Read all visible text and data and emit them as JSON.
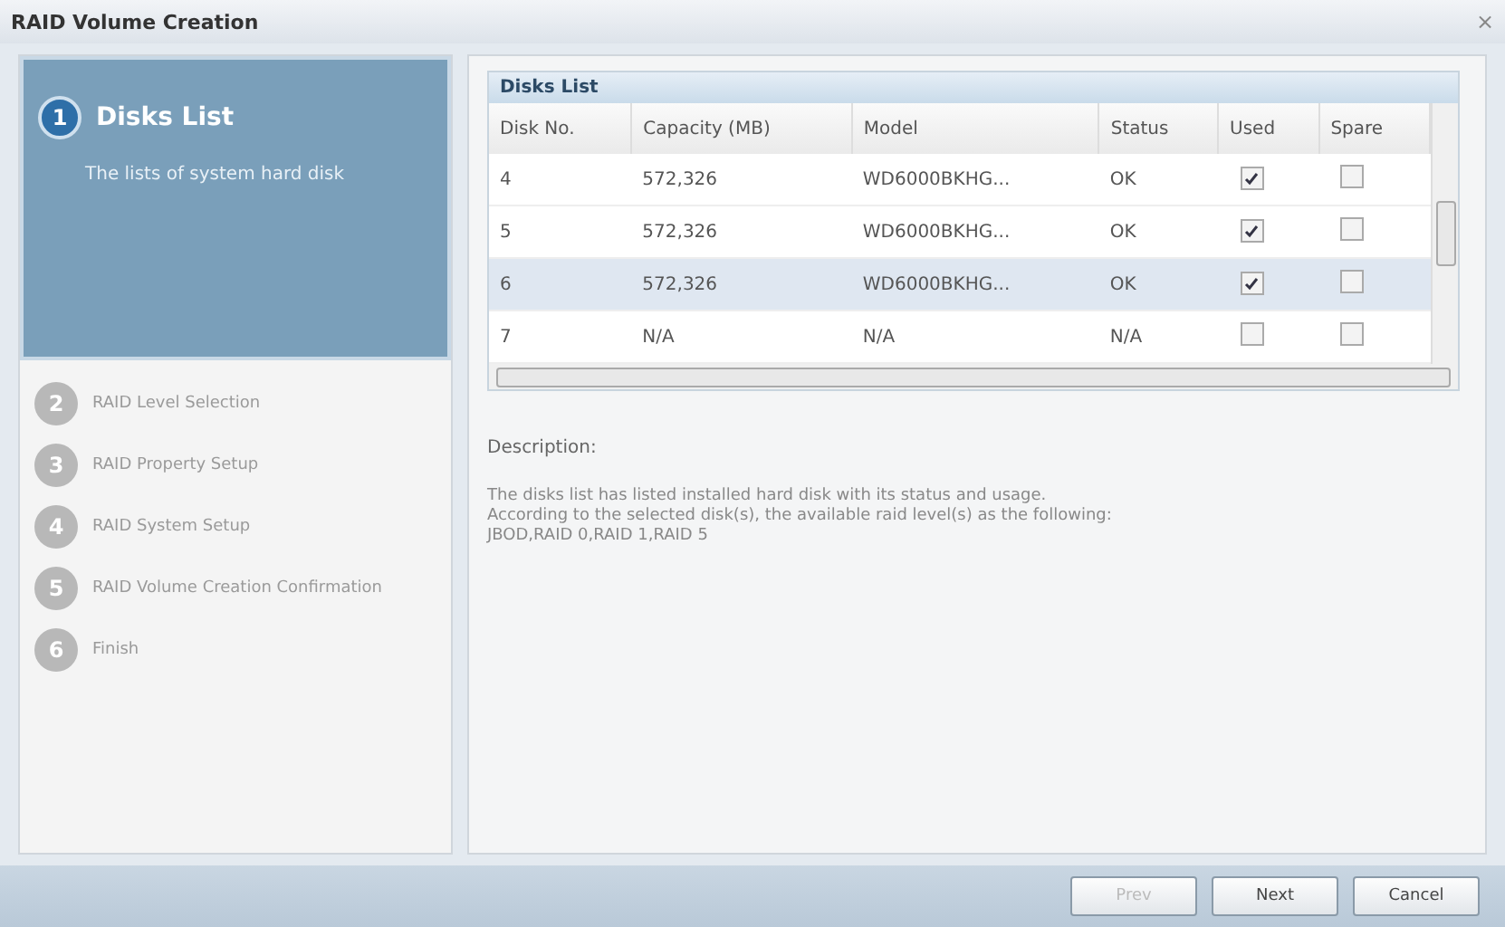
{
  "window": {
    "title": "RAID Volume Creation",
    "close": "×"
  },
  "steps": [
    {
      "number": "1",
      "label": "Disks List",
      "description": "The lists of system hard disk",
      "selected": true
    },
    {
      "number": "2",
      "label": "RAID Level Selection",
      "selected": false
    },
    {
      "number": "3",
      "label": "RAID Property Setup",
      "selected": false
    },
    {
      "number": "4",
      "label": "RAID System Setup",
      "selected": false
    },
    {
      "number": "5",
      "label": "RAID Volume Creation Confirmation",
      "selected": false
    },
    {
      "number": "6",
      "label": "Finish",
      "selected": false
    }
  ],
  "disks_list": {
    "title": "Disks List",
    "columns": [
      "Disk No.",
      "Capacity (MB)",
      "Model",
      "Status",
      "Used",
      "Spare"
    ],
    "rows": [
      {
        "disk_no": "4",
        "capacity": "572,326",
        "model": "WD6000BKHG...",
        "status": "OK",
        "used": true,
        "spare": false,
        "selected": false
      },
      {
        "disk_no": "5",
        "capacity": "572,326",
        "model": "WD6000BKHG...",
        "status": "OK",
        "used": true,
        "spare": false,
        "selected": false
      },
      {
        "disk_no": "6",
        "capacity": "572,326",
        "model": "WD6000BKHG...",
        "status": "OK",
        "used": true,
        "spare": false,
        "selected": true
      },
      {
        "disk_no": "7",
        "capacity": "N/A",
        "model": "N/A",
        "status": "N/A",
        "used": false,
        "spare": false,
        "selected": false
      }
    ]
  },
  "description": {
    "heading": "Description:",
    "lines": [
      "The disks list has listed installed hard disk with its status and usage.",
      "According to the selected disk(s), the available raid level(s) as the following:",
      "JBOD,RAID 0,RAID 1,RAID 5"
    ]
  },
  "buttons": [
    {
      "label": "Prev",
      "disabled": true
    },
    {
      "label": "Next",
      "disabled": false
    },
    {
      "label": "Cancel",
      "disabled": false
    }
  ]
}
